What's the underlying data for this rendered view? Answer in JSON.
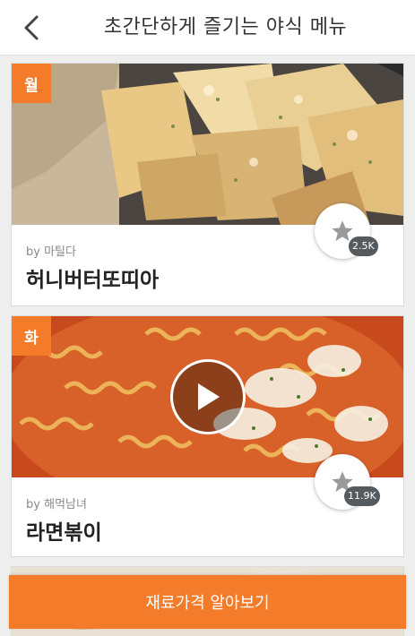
{
  "header": {
    "title": "초간단하게 즐기는 야식 메뉴",
    "back_icon": "chevron-left-icon"
  },
  "cards": [
    {
      "day": "월",
      "author": "by 마틸다",
      "title": "허니버터또띠아",
      "favorites": "2.5K",
      "has_video": false
    },
    {
      "day": "화",
      "author": "by 해먹남녀",
      "title": "라면볶이",
      "favorites": "11.9K",
      "has_video": true
    }
  ],
  "cta": {
    "label": "재료가격 알아보기"
  },
  "colors": {
    "accent": "#f47b2a",
    "badge": "#555a5e"
  }
}
